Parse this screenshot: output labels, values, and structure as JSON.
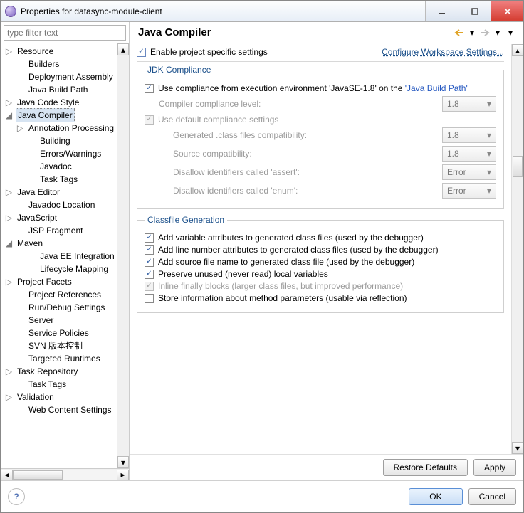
{
  "window": {
    "title": "Properties for datasync-module-client"
  },
  "filter": {
    "placeholder": "type filter text"
  },
  "tree": [
    {
      "label": "Resource",
      "depth": 0,
      "twisty": "closed"
    },
    {
      "label": "Builders",
      "depth": 1,
      "twisty": "none"
    },
    {
      "label": "Deployment Assembly",
      "depth": 1,
      "twisty": "none"
    },
    {
      "label": "Java Build Path",
      "depth": 1,
      "twisty": "none"
    },
    {
      "label": "Java Code Style",
      "depth": 0,
      "twisty": "closed"
    },
    {
      "label": "Java Compiler",
      "depth": 0,
      "twisty": "open",
      "selected": true
    },
    {
      "label": "Annotation Processing",
      "depth": 1,
      "twisty": "closed"
    },
    {
      "label": "Building",
      "depth": 2,
      "twisty": "none"
    },
    {
      "label": "Errors/Warnings",
      "depth": 2,
      "twisty": "none"
    },
    {
      "label": "Javadoc",
      "depth": 2,
      "twisty": "none"
    },
    {
      "label": "Task Tags",
      "depth": 2,
      "twisty": "none"
    },
    {
      "label": "Java Editor",
      "depth": 0,
      "twisty": "closed"
    },
    {
      "label": "Javadoc Location",
      "depth": 1,
      "twisty": "none"
    },
    {
      "label": "JavaScript",
      "depth": 0,
      "twisty": "closed"
    },
    {
      "label": "JSP Fragment",
      "depth": 1,
      "twisty": "none"
    },
    {
      "label": "Maven",
      "depth": 0,
      "twisty": "open"
    },
    {
      "label": "Java EE Integration",
      "depth": 2,
      "twisty": "none"
    },
    {
      "label": "Lifecycle Mapping",
      "depth": 2,
      "twisty": "none"
    },
    {
      "label": "Project Facets",
      "depth": 0,
      "twisty": "closed"
    },
    {
      "label": "Project References",
      "depth": 1,
      "twisty": "none"
    },
    {
      "label": "Run/Debug Settings",
      "depth": 1,
      "twisty": "none"
    },
    {
      "label": "Server",
      "depth": 1,
      "twisty": "none"
    },
    {
      "label": "Service Policies",
      "depth": 1,
      "twisty": "none"
    },
    {
      "label": "SVN 版本控制",
      "depth": 1,
      "twisty": "none"
    },
    {
      "label": "Targeted Runtimes",
      "depth": 1,
      "twisty": "none"
    },
    {
      "label": "Task Repository",
      "depth": 0,
      "twisty": "closed"
    },
    {
      "label": "Task Tags",
      "depth": 1,
      "twisty": "none"
    },
    {
      "label": "Validation",
      "depth": 0,
      "twisty": "closed"
    },
    {
      "label": "Web Content Settings",
      "depth": 1,
      "twisty": "none"
    }
  ],
  "page": {
    "title": "Java Compiler",
    "enable_label": "Enable project specific settings",
    "configure_link": "Configure Workspace Settings...",
    "group1": {
      "legend": "JDK Compliance",
      "use_exec_prefix": "Use compliance from execution environment 'JavaSE-1.8' on the ",
      "use_exec_mnemonic": "U",
      "build_path_link": "'Java Build Path'",
      "compiler_level_label": "Compiler compliance level:",
      "compiler_level_value": "1.8",
      "use_default_label": "Use default compliance settings",
      "gen_class_label": "Generated .class files compatibility:",
      "gen_class_value": "1.8",
      "source_compat_label": "Source compatibility:",
      "source_compat_value": "1.8",
      "assert_label": "Disallow identifiers called 'assert':",
      "assert_value": "Error",
      "enum_label": "Disallow identifiers called 'enum':",
      "enum_value": "Error"
    },
    "group2": {
      "legend": "Classfile Generation",
      "opt1": "Add variable attributes to generated class files (used by the debugger)",
      "opt2": "Add line number attributes to generated class files (used by the debugger)",
      "opt3": "Add source file name to generated class file (used by the debugger)",
      "opt4": "Preserve unused (never read) local variables",
      "opt5": "Inline finally blocks (larger class files, but improved performance)",
      "opt6": "Store information about method parameters (usable via reflection)"
    }
  },
  "buttons": {
    "restore": "Restore Defaults",
    "apply": "Apply",
    "ok": "OK",
    "cancel": "Cancel"
  }
}
